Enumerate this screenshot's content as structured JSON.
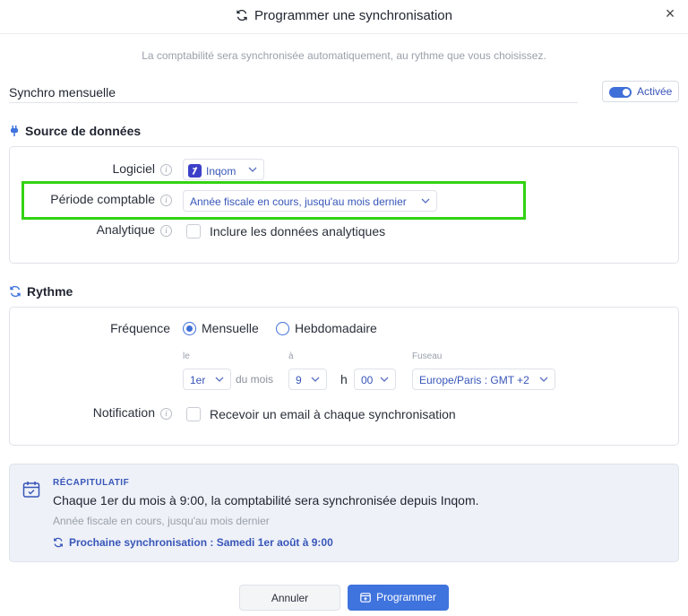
{
  "dialog": {
    "title": "Programmer une synchronisation",
    "close_label": "×",
    "subtitle": "La comptabilité sera synchronisée automatiquement, au rythme que vous choisissez.",
    "title_icon": "sync-icon"
  },
  "schedule": {
    "name_value": "Synchro mensuelle",
    "toggle_label": "Activée",
    "toggle_on": true
  },
  "source": {
    "title": "Source de données",
    "icon": "plug-icon",
    "software_label": "Logiciel",
    "software_value": "Inqom",
    "period_label": "Période comptable",
    "period_value": "Année fiscale en cours, jusqu'au mois dernier",
    "analytics_label": "Analytique",
    "analytics_checkbox_label": "Inclure les données analytiques",
    "analytics_checked": false
  },
  "rhythm": {
    "title": "Rythme",
    "icon": "sync-icon",
    "frequency_label": "Fréquence",
    "options": [
      "Mensuelle",
      "Hebdomadaire"
    ],
    "selected_option": "Mensuelle",
    "day_caption": "le",
    "day_value": "1er",
    "day_suffix": "du mois",
    "time_caption": "à",
    "hour_value": "9",
    "hour_sep": "h",
    "minute_value": "00",
    "timezone_caption": "Fuseau",
    "timezone_value": "Europe/Paris : GMT +2",
    "notification_label": "Notification",
    "notification_checkbox_label": "Recevoir un email à chaque synchronisation",
    "notification_checked": false
  },
  "recap": {
    "heading": "RÉCAPITULATIF",
    "main": "Chaque 1er du mois à 9:00, la comptabilité sera synchronisée depuis Inqom.",
    "sub": "Année fiscale en cours, jusqu'au mois dernier",
    "next": "Prochaine synchronisation : Samedi 1er août à 9:00",
    "icon": "calendar-icon"
  },
  "actions": {
    "cancel_label": "Annuler",
    "submit_label": "Programmer"
  },
  "colors": {
    "accent": "#3f73de",
    "link": "#3856b8",
    "highlight": "#32d312",
    "recap_bg": "#eef1f8"
  }
}
